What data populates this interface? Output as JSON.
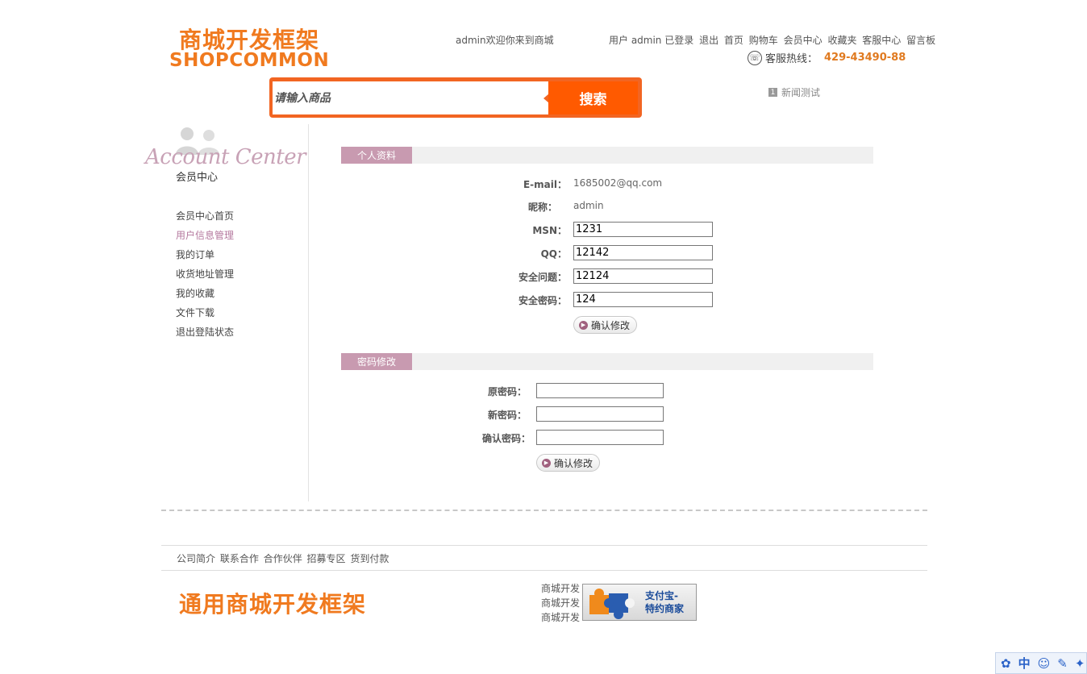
{
  "header": {
    "logo_cn": "商城开发框架",
    "logo_en": "SHOPCOMMON",
    "welcome": "admin欢迎你来到商城",
    "topnav": [
      "用户 admin 已登录",
      "退出",
      "首页",
      "购物车",
      "会员中心",
      "收藏夹",
      "客服中心",
      "留言板"
    ],
    "hotline_label": "客服热线：",
    "hotline_number": "429-43490-88",
    "search_placeholder": "请输入商品",
    "search_button": "搜索",
    "news_num": "1",
    "news_text": "新闻测试"
  },
  "sidebar": {
    "title_en": "Account Center",
    "title_cn": "会员中心",
    "items": [
      {
        "label": "会员中心首页"
      },
      {
        "label": "用户信息管理",
        "active": true
      },
      {
        "label": "我的订单"
      },
      {
        "label": "收货地址管理"
      },
      {
        "label": "我的收藏"
      },
      {
        "label": "文件下载"
      },
      {
        "label": "退出登陆状态"
      }
    ]
  },
  "profile": {
    "section_title": "个人资料",
    "email_label": "E-mail：",
    "email_value": "1685002@qq.com",
    "nickname_label": "昵称：",
    "nickname_value": "admin",
    "msn_label": "MSN：",
    "msn_value": "1231",
    "qq_label": "QQ：",
    "qq_value": "12142",
    "question_label": "安全问题：",
    "question_value": "12124",
    "answer_label": "安全密码：",
    "answer_value": "124",
    "submit_label": "确认修改"
  },
  "password": {
    "section_title": "密码修改",
    "old_label": "原密码：",
    "old_value": "",
    "new_label": "新密码：",
    "new_value": "",
    "confirm_label": "确认密码：",
    "confirm_value": "",
    "submit_label": "确认修改"
  },
  "footer": {
    "links": [
      "公司简介",
      "联系合作",
      "合作伙伴",
      "招募专区",
      "货到付款"
    ],
    "logo": "通用商城开发框架",
    "side_lines": [
      "商城开发",
      "商城开发",
      "商城开发"
    ],
    "alipay_line1": "支付宝-",
    "alipay_line2": "特约商家"
  },
  "ime": {
    "lang": "中"
  },
  "colors": {
    "brand_orange": "#f07a1f",
    "search_orange": "#ff5a00",
    "section_tab": "#c89ab0",
    "active_menu": "#b4789e"
  }
}
